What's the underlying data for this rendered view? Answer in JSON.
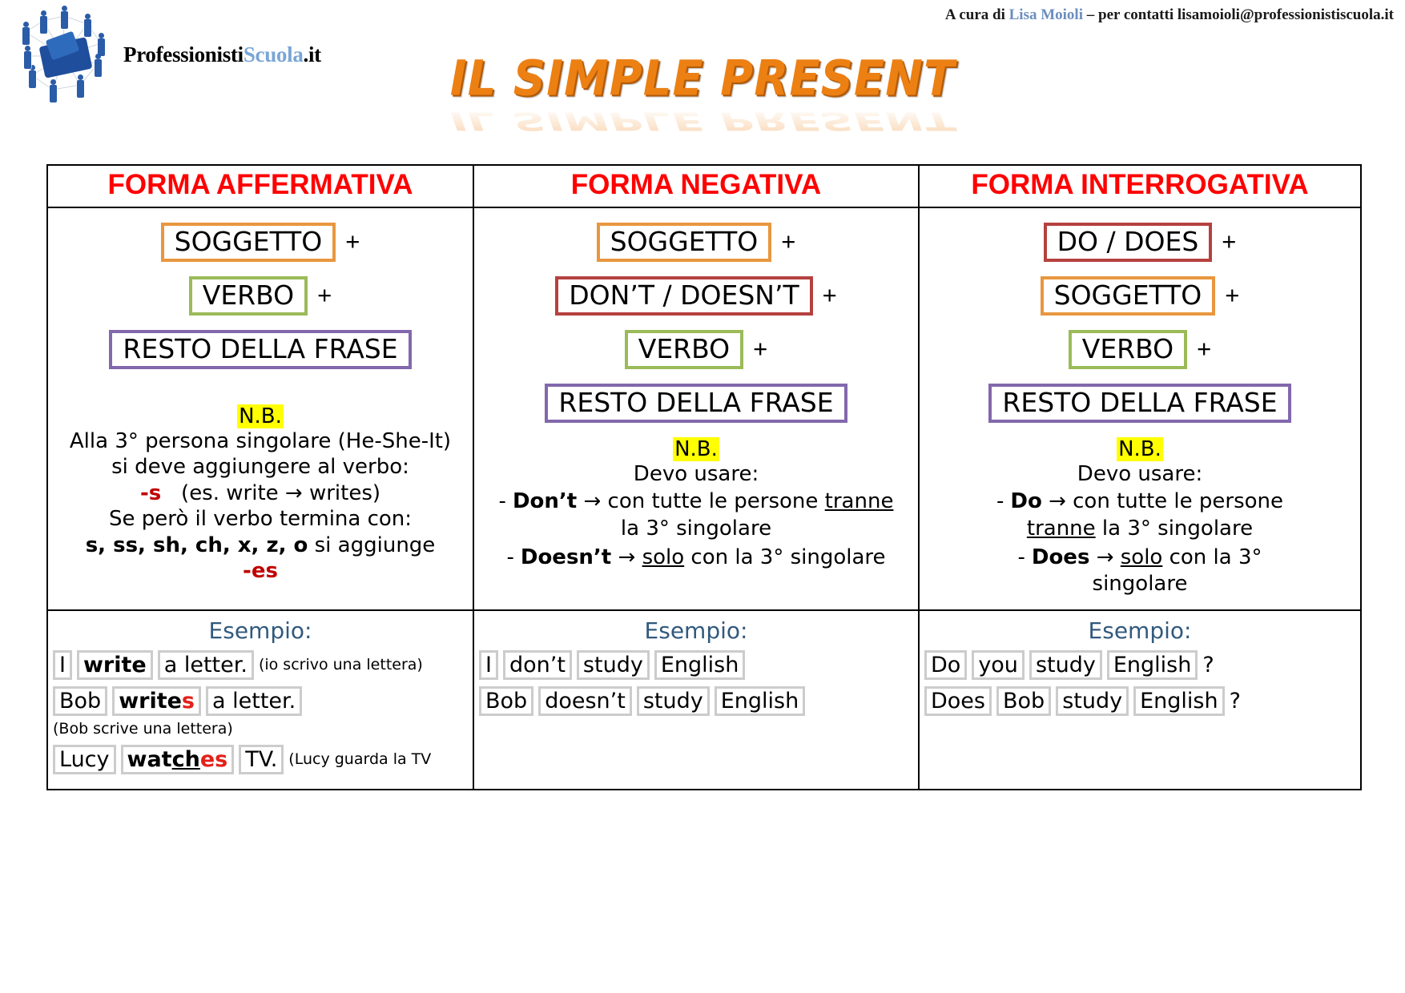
{
  "header": {
    "credit_prefix": "A cura di ",
    "credit_name": "Lisa Moioli",
    "credit_suffix": " – per contatti lisamoioli@professionistiscuola.it",
    "logo_text_a": "Professionisti",
    "logo_text_b": "Scuola",
    "logo_text_c": ".it",
    "title": "IL SIMPLE PRESENT"
  },
  "colors": {
    "subject": "#e8973f",
    "verb": "#9bbb59",
    "rest": "#8268ac",
    "auxiliary": "#b5413f",
    "heading_red": "#ff0000",
    "highlight": "#ffff00",
    "example_blue": "#31597d",
    "accent_red_text": "#c00000"
  },
  "columns": [
    {
      "heading": "FORMA AFFERMATIVA",
      "structure": [
        {
          "label": "SOGGETTO",
          "color": "orange",
          "plus": "+"
        },
        {
          "label": "VERBO",
          "color": "green",
          "plus": "+"
        },
        {
          "label": "RESTO DELLA FRASE",
          "color": "purple",
          "plus": ""
        }
      ],
      "nb_label": "N.B.",
      "note_lines": [
        "Alla 3° persona singolare (He-She-It)",
        "si deve aggiungere al verbo:"
      ],
      "note_rule1_suffix": "-s",
      "note_rule1_example": "(es. write → writes)",
      "note_line3": "Se però il verbo termina con:",
      "note_endings": "s, ss, sh, ch, x, z, o",
      "note_endings_tail": " si aggiunge",
      "note_rule2_suffix": "-es",
      "example_title": "Esempio:",
      "examples": [
        {
          "parts": [
            {
              "text": "I",
              "color": "orange"
            },
            {
              "text": "write",
              "color": "green",
              "bold": true
            },
            {
              "text": "a letter.",
              "color": "purple"
            }
          ],
          "gloss": "(io scrivo una lettera)"
        },
        {
          "parts": [
            {
              "text": "Bob",
              "color": "orange"
            },
            {
              "text": "write",
              "color": "green",
              "bold": true,
              "red_tail": "s"
            },
            {
              "text": "a letter.",
              "color": "purple"
            }
          ],
          "gloss": "(Bob scrive una lettera)"
        },
        {
          "parts": [
            {
              "text": "Lucy",
              "color": "orange"
            },
            {
              "text": "wat",
              "color": "green",
              "bold": true,
              "underline_mid": "ch",
              "red_tail": "es"
            },
            {
              "text": "TV.",
              "color": "purple"
            }
          ],
          "gloss": "(Lucy guarda la TV"
        }
      ]
    },
    {
      "heading": "FORMA NEGATIVA",
      "structure": [
        {
          "label": "SOGGETTO",
          "color": "orange",
          "plus": "+"
        },
        {
          "label": "DON’T / DOESN’T",
          "color": "red",
          "plus": "+"
        },
        {
          "label": "VERBO",
          "color": "green",
          "plus": "+"
        },
        {
          "label": "RESTO DELLA FRASE",
          "color": "purple",
          "plus": ""
        }
      ],
      "nb_label": "N.B.",
      "note_intro": "Devo usare:",
      "bullets": [
        {
          "dash": "-",
          "bold": "Don’t",
          "arrow": "→",
          "rest_pre": " con tutte le persone ",
          "rest_underline": "tranne",
          "rest_post": "",
          "line2": "la 3° singolare"
        },
        {
          "dash": "-",
          "bold": "Doesn’t",
          "arrow": "→",
          "rest_pre": " ",
          "rest_underline": "solo",
          "rest_post": " con la 3° singolare",
          "line2": ""
        }
      ],
      "example_title": "Esempio:",
      "examples": [
        {
          "parts": [
            {
              "text": "I",
              "color": "orange"
            },
            {
              "text": "don’t",
              "color": "red"
            },
            {
              "text": "study",
              "color": "green"
            },
            {
              "text": "English",
              "color": "purple"
            }
          ],
          "gloss": ""
        },
        {
          "parts": [
            {
              "text": "Bob",
              "color": "orange"
            },
            {
              "text": "doesn’t",
              "color": "red"
            },
            {
              "text": "study",
              "color": "green"
            },
            {
              "text": "English",
              "color": "purple"
            }
          ],
          "gloss": ""
        }
      ]
    },
    {
      "heading": "FORMA INTERROGATIVA",
      "structure": [
        {
          "label": "DO / DOES",
          "color": "red",
          "plus": "+"
        },
        {
          "label": "SOGGETTO",
          "color": "orange",
          "plus": "+"
        },
        {
          "label": "VERBO",
          "color": "green",
          "plus": "+"
        },
        {
          "label": "RESTO DELLA FRASE",
          "color": "purple",
          "plus": ""
        }
      ],
      "nb_label": "N.B.",
      "note_intro": "Devo usare:",
      "bullets": [
        {
          "dash": "-",
          "bold": "Do",
          "arrow": "→",
          "rest_pre": " con tutte le persone",
          "rest_underline": "tranne",
          "rest_post": " la 3° singolare",
          "line2": ""
        },
        {
          "dash": "-",
          "bold": "Does",
          "arrow": "→",
          "rest_pre": " ",
          "rest_underline": "solo",
          "rest_post": " con la 3°",
          "line2": "singolare"
        }
      ],
      "example_title": "Esempio:",
      "examples": [
        {
          "parts": [
            {
              "text": "Do",
              "color": "red"
            },
            {
              "text": "you",
              "color": "orange"
            },
            {
              "text": "study",
              "color": "green"
            },
            {
              "text": "English",
              "color": "purple"
            }
          ],
          "gloss": "?"
        },
        {
          "parts": [
            {
              "text": "Does",
              "color": "red"
            },
            {
              "text": "Bob",
              "color": "orange"
            },
            {
              "text": "study",
              "color": "green"
            },
            {
              "text": "English",
              "color": "purple"
            }
          ],
          "gloss": "?"
        }
      ]
    }
  ]
}
